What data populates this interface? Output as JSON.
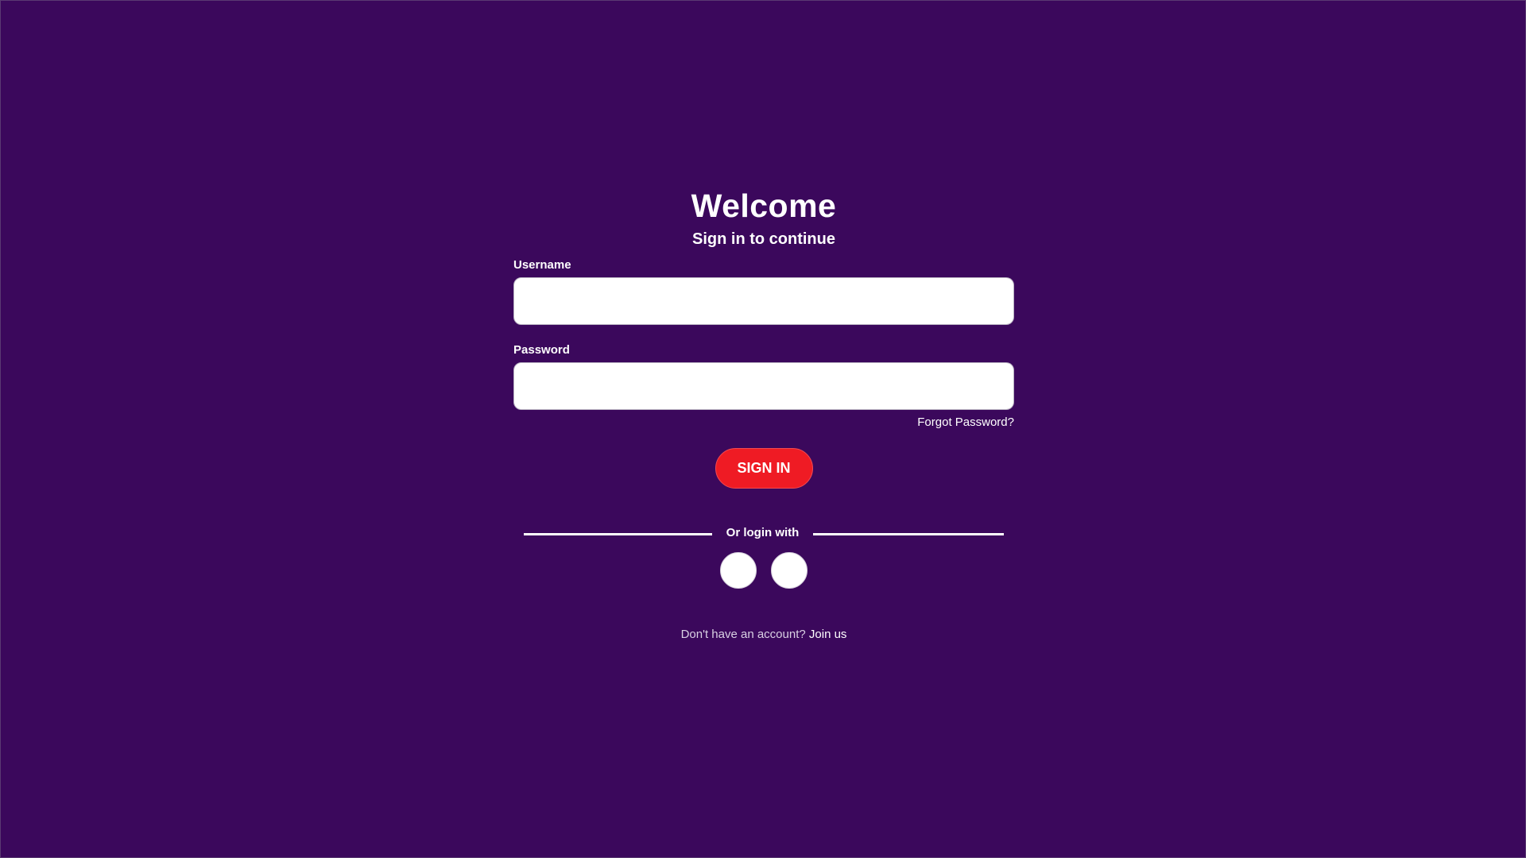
{
  "login": {
    "title": "Welcome",
    "subtitle": "Sign in to continue",
    "username": {
      "label": "Username",
      "value": "",
      "placeholder": ""
    },
    "password": {
      "label": "Password",
      "value": "",
      "placeholder": ""
    },
    "forgot_password_label": "Forgot Password?",
    "sign_in_label": "SIGN IN",
    "divider_text": "Or login with",
    "social_buttons": [
      {
        "icon": "social-login-icon"
      },
      {
        "icon": "social-login-icon"
      }
    ],
    "signup_prompt": "Don't have an account?",
    "join_label": "Join us"
  },
  "colors": {
    "background": "#3b085c",
    "primary_button": "#ef1b24",
    "input_background": "#ffffff",
    "text": "#ffffff"
  }
}
